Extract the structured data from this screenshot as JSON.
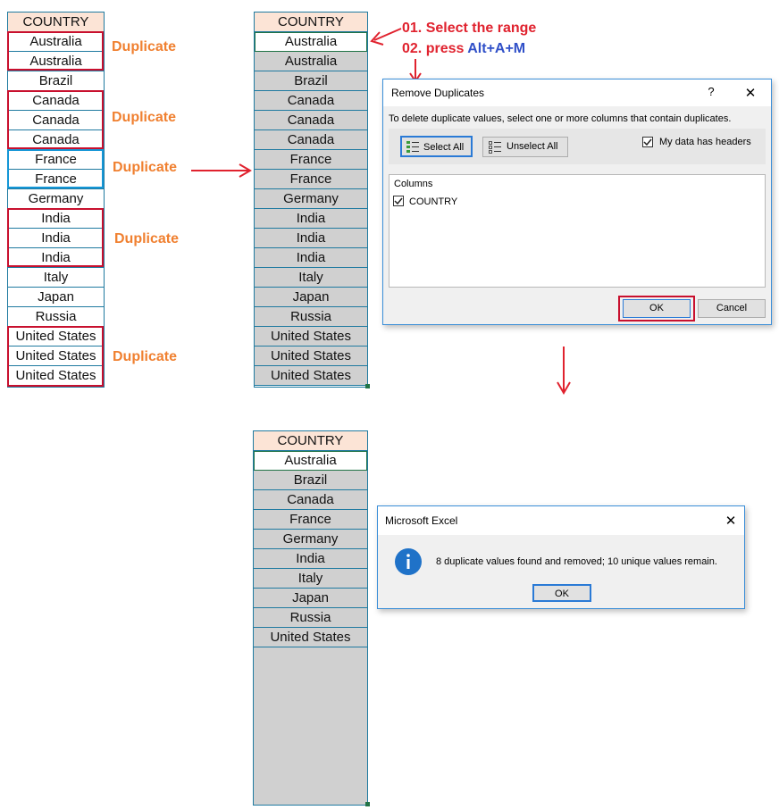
{
  "header_label": "COUNTRY",
  "original_list": [
    "Australia",
    "Australia",
    "Brazil",
    "Canada",
    "Canada",
    "Canada",
    "France",
    "France",
    "Germany",
    "India",
    "India",
    "India",
    "Italy",
    "Japan",
    "Russia",
    "United States",
    "United States",
    "United States"
  ],
  "unique_list": [
    "Australia",
    "Brazil",
    "Canada",
    "France",
    "Germany",
    "India",
    "Italy",
    "Japan",
    "Russia",
    "United States"
  ],
  "duplicate_label": "Duplicate",
  "instructions": {
    "step1": "01. Select the range",
    "step2_prefix": "02. press ",
    "step2_keys": "Alt+A+M"
  },
  "remove_duplicates_dialog": {
    "title": "Remove Duplicates",
    "help": "?",
    "close": "✕",
    "description": "To delete duplicate values, select one or more columns that contain duplicates.",
    "select_all": "Select All",
    "unselect_all": "Unselect All",
    "headers_label": "My data has headers",
    "headers_checked": true,
    "columns_label": "Columns",
    "columns": [
      {
        "name": "COUNTRY",
        "checked": true
      }
    ],
    "ok": "OK",
    "cancel": "Cancel"
  },
  "excel_message": {
    "title": "Microsoft Excel",
    "close": "✕",
    "message": "8 duplicate values found and removed; 10 unique values remain.",
    "ok": "OK",
    "icon": "info-icon"
  },
  "colors": {
    "accent_red": "#c8102e",
    "orange": "#f08030",
    "blue_key": "#3050c8",
    "header_fill": "#fce4d6",
    "selection_grey": "#d0d0d0"
  }
}
